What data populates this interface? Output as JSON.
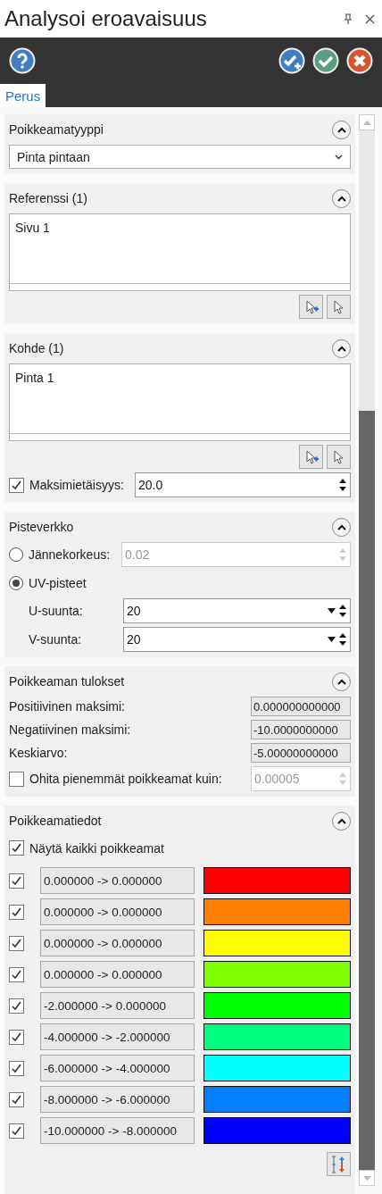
{
  "window": {
    "title": "Analysoi eroavaisuus"
  },
  "tabs": [
    {
      "label": "Perus",
      "selected": true
    }
  ],
  "deviation_type": {
    "title": "Poikkeamatyyppi",
    "value": "Pinta pintaan"
  },
  "reference": {
    "title": "Referenssi (1)",
    "items": [
      "Sivu 1"
    ]
  },
  "target": {
    "title": "Kohde (1)",
    "items": [
      "Pinta 1"
    ],
    "max_distance": {
      "label": "Maksimietäisyys:",
      "checked": true,
      "value": "20.0"
    }
  },
  "point_grid": {
    "title": "Pisteverkko",
    "options": [
      {
        "label": "Jännekorkeus:",
        "selected": false,
        "value": "0.02"
      },
      {
        "label": "UV-pisteet",
        "selected": true
      }
    ],
    "u": {
      "label": "U-suunta:",
      "value": "20"
    },
    "v": {
      "label": "V-suunta:",
      "value": "20"
    }
  },
  "results": {
    "title": "Poikkeaman tulokset",
    "rows": [
      {
        "label": "Positiivinen maksimi:",
        "value": "0.000000000000"
      },
      {
        "label": "Negatiivinen maksimi:",
        "value": "-10.0000000000"
      },
      {
        "label": "Keskiarvo:",
        "value": "-5.00000000000"
      }
    ],
    "ignore": {
      "label": "Ohita pienemmät poikkeamat kuin:",
      "checked": false,
      "value": "0.00005"
    }
  },
  "legend": {
    "title": "Poikkeamatiedot",
    "show_all": {
      "label": "Näytä kaikki poikkeamat",
      "checked": true
    },
    "rows": [
      {
        "range": "0.000000 -> 0.000000",
        "checked": true,
        "color": "#ff0000"
      },
      {
        "range": "0.000000 -> 0.000000",
        "checked": true,
        "color": "#ff8000"
      },
      {
        "range": "0.000000 -> 0.000000",
        "checked": true,
        "color": "#ffff00"
      },
      {
        "range": "0.000000 -> 0.000000",
        "checked": true,
        "color": "#80ff00"
      },
      {
        "range": "-2.000000 -> 0.000000",
        "checked": true,
        "color": "#00ff00"
      },
      {
        "range": "-4.000000 -> -2.000000",
        "checked": true,
        "color": "#00ff80"
      },
      {
        "range": "-6.000000 -> -4.000000",
        "checked": true,
        "color": "#00ffff"
      },
      {
        "range": "-8.000000 -> -6.000000",
        "checked": true,
        "color": "#0080ff"
      },
      {
        "range": "-10.000000 -> -8.000000",
        "checked": true,
        "color": "#0000ff"
      }
    ]
  }
}
